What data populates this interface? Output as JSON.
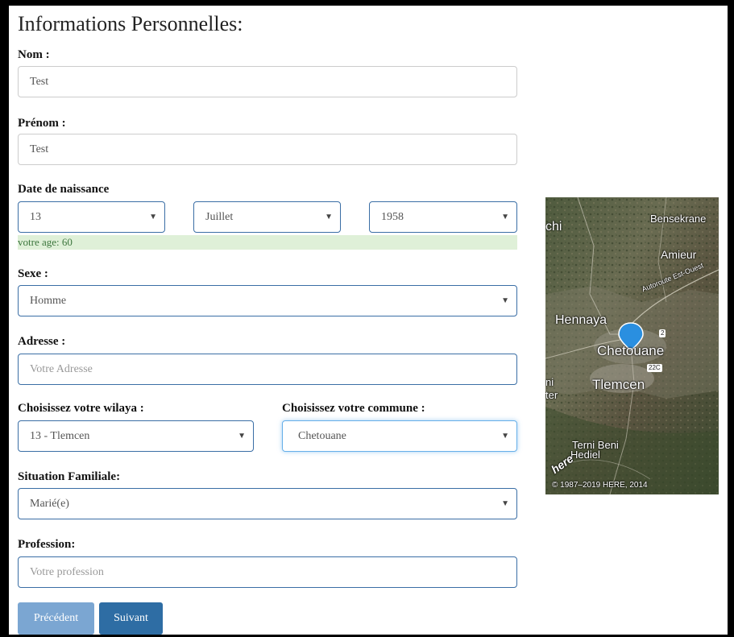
{
  "form": {
    "title": "Informations Personnelles:",
    "nom": {
      "label": "Nom :",
      "value": "Test"
    },
    "prenom": {
      "label": "Prénom :",
      "value": "Test"
    },
    "dob": {
      "label": "Date de naissance",
      "day": "13",
      "month": "Juillet",
      "year": "1958"
    },
    "age_text": "votre age: 60",
    "sexe": {
      "label": "Sexe :",
      "value": "Homme"
    },
    "adresse": {
      "label": "Adresse :",
      "placeholder": "Votre Adresse"
    },
    "wilaya": {
      "label": "Choisissez votre wilaya :",
      "value": "13 - Tlemcen"
    },
    "commune": {
      "label": "Choisissez votre commune :",
      "value": "Chetouane"
    },
    "situation": {
      "label": "Situation Familiale:",
      "value": "Marié(e)"
    },
    "profession": {
      "label": "Profession:",
      "placeholder": "Votre profession"
    }
  },
  "buttons": {
    "prev": "Précédent",
    "next": "Suivant"
  },
  "map": {
    "places": {
      "bensekrane": "Bensekrane",
      "amieur": "Amieur",
      "hennaya": "Hennaya",
      "chetouane": "Chetouane",
      "tlemcen": "Tlemcen",
      "terni": "Terni Beni",
      "hediel": "Hediel",
      "chi": "chi",
      "ni": "ni",
      "ter": "ter",
      "autoroute": "Autoroute Est-Ouest"
    },
    "shields": {
      "r2": "2",
      "r22c": "22C"
    },
    "brand": "here",
    "copyright": "© 1987–2019 HERE, 2014"
  },
  "colors": {
    "accent": "#2e6da4",
    "accent_disabled": "#7ba6d2",
    "success_bg": "#dff0d8",
    "success_text": "#3c763d",
    "pin": "#2a8fe0"
  },
  "icons": {
    "caret": "caret-down-icon",
    "pin": "map-pin-icon"
  }
}
